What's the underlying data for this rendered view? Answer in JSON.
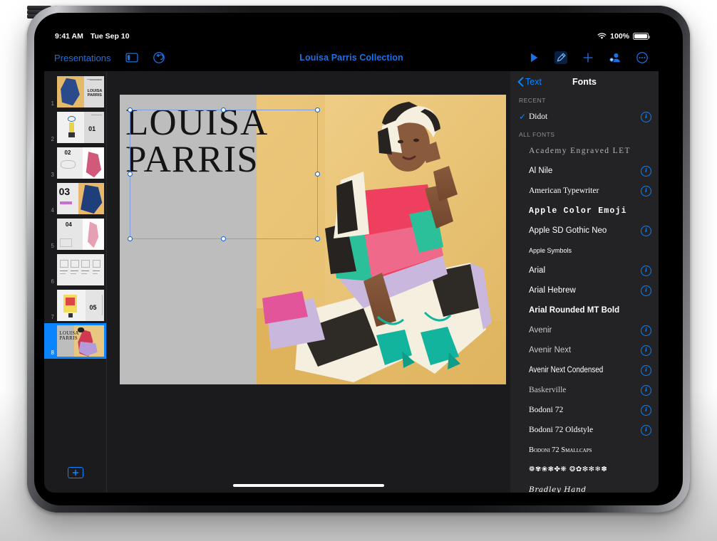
{
  "status_bar": {
    "time": "9:41 AM",
    "date": "Tue Sep 10",
    "battery_percent": "100%",
    "wifi_icon": "wifi-icon",
    "battery_icon": "battery-icon"
  },
  "toolbar": {
    "back_label": "Presentations",
    "sidebar_icon": "sidebar-toggle-icon",
    "undo_icon": "undo-icon",
    "document_title": "Louisa Parris Collection",
    "play_icon": "play-icon",
    "format_icon": "format-brush-icon",
    "insert_icon": "plus-icon",
    "collaborate_icon": "add-person-icon",
    "more_icon": "more-ellipsis-icon"
  },
  "navigator": {
    "add_slide_label": "+",
    "slides": [
      {
        "number": "1",
        "selected": false
      },
      {
        "number": "2",
        "selected": false
      },
      {
        "number": "3",
        "selected": false
      },
      {
        "number": "4",
        "selected": false
      },
      {
        "number": "5",
        "selected": false
      },
      {
        "number": "6",
        "selected": false
      },
      {
        "number": "7",
        "selected": false
      },
      {
        "number": "8",
        "selected": true
      }
    ]
  },
  "slide": {
    "title_text": "LOUISA\nPARRIS",
    "gray_panel_color": "#bdbdbd",
    "background_color": "#e8c880",
    "selection_handles": 8
  },
  "fonts_panel": {
    "back_label": "Text",
    "title": "Fonts",
    "section_recent": "RECENT",
    "section_all": "ALL FONTS",
    "info_glyph": "i",
    "check_glyph": "✓",
    "recent": [
      {
        "name": "Didot",
        "checked": true,
        "info": true,
        "style": "f-serif"
      }
    ],
    "all_fonts": [
      {
        "name": "Academy Engraved LET",
        "checked": false,
        "info": false,
        "style": "f-serif f-dimmer f-spaced"
      },
      {
        "name": "Al Nile",
        "checked": false,
        "info": true,
        "style": "f-sans"
      },
      {
        "name": "American Typewriter",
        "checked": false,
        "info": true,
        "style": "f-serif"
      },
      {
        "name": "Apple Color Emoji",
        "checked": false,
        "info": false,
        "style": "f-mono f-bold"
      },
      {
        "name": "Apple SD Gothic Neo",
        "checked": false,
        "info": true,
        "style": "f-sans"
      },
      {
        "name": "Apple Symbols",
        "checked": false,
        "info": false,
        "style": "f-sans f-small"
      },
      {
        "name": "Arial",
        "checked": false,
        "info": true,
        "style": "f-sans"
      },
      {
        "name": "Arial Hebrew",
        "checked": false,
        "info": true,
        "style": "f-sans"
      },
      {
        "name": "Arial Rounded MT Bold",
        "checked": false,
        "info": false,
        "style": "f-sans f-bold"
      },
      {
        "name": "Avenir",
        "checked": false,
        "info": true,
        "style": "f-sans f-dim"
      },
      {
        "name": "Avenir Next",
        "checked": false,
        "info": true,
        "style": "f-sans f-dim"
      },
      {
        "name": "Avenir Next Condensed",
        "checked": false,
        "info": true,
        "style": "f-condensed"
      },
      {
        "name": "Baskerville",
        "checked": false,
        "info": true,
        "style": "f-serif f-dim"
      },
      {
        "name": "Bodoni 72",
        "checked": false,
        "info": true,
        "style": "f-serif"
      },
      {
        "name": "Bodoni 72 Oldstyle",
        "checked": false,
        "info": true,
        "style": "f-serif"
      },
      {
        "name": "Bodoni 72 Smallcaps",
        "checked": false,
        "info": false,
        "style": "f-smallcaps"
      },
      {
        "name": "❁✾❀❃✤❋ ❂✿❇✻❄✽",
        "checked": false,
        "info": false,
        "style": "f-ornament"
      },
      {
        "name": "Bradley Hand",
        "checked": false,
        "info": false,
        "style": "f-script"
      }
    ]
  },
  "colors": {
    "accent_blue": "#0a84ff",
    "title_blue": "#1b72e8",
    "panel_bg": "#232325",
    "app_bg": "#1b1b1d",
    "selected_row": "#0a84ff"
  }
}
